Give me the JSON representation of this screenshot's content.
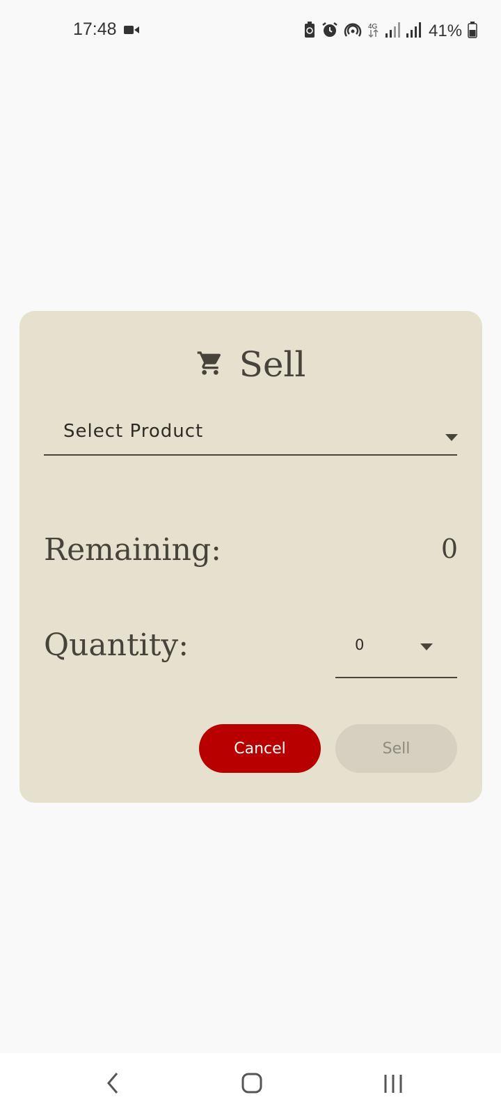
{
  "status_bar": {
    "time": "17:48",
    "battery": "41%",
    "icons": [
      "video-camera-icon",
      "battery-saver-icon",
      "alarm-icon",
      "hotspot-icon",
      "4g-icon",
      "signal-icon",
      "signal-icon",
      "battery-icon"
    ]
  },
  "dialog": {
    "title": "Sell",
    "title_icon": "cart-icon",
    "product_select": {
      "placeholder": "Select Product"
    },
    "remaining": {
      "label": "Remaining:",
      "value": "0"
    },
    "quantity": {
      "label": "Quantity:",
      "value": "0"
    },
    "buttons": {
      "cancel": "Cancel",
      "sell": "Sell"
    },
    "colors": {
      "background": "#e6e1cf",
      "cancel": "#b80000",
      "sell_disabled": "#d5d0c0"
    }
  },
  "nav_bar": {
    "icons": [
      "back-icon",
      "home-icon",
      "recents-icon"
    ]
  }
}
